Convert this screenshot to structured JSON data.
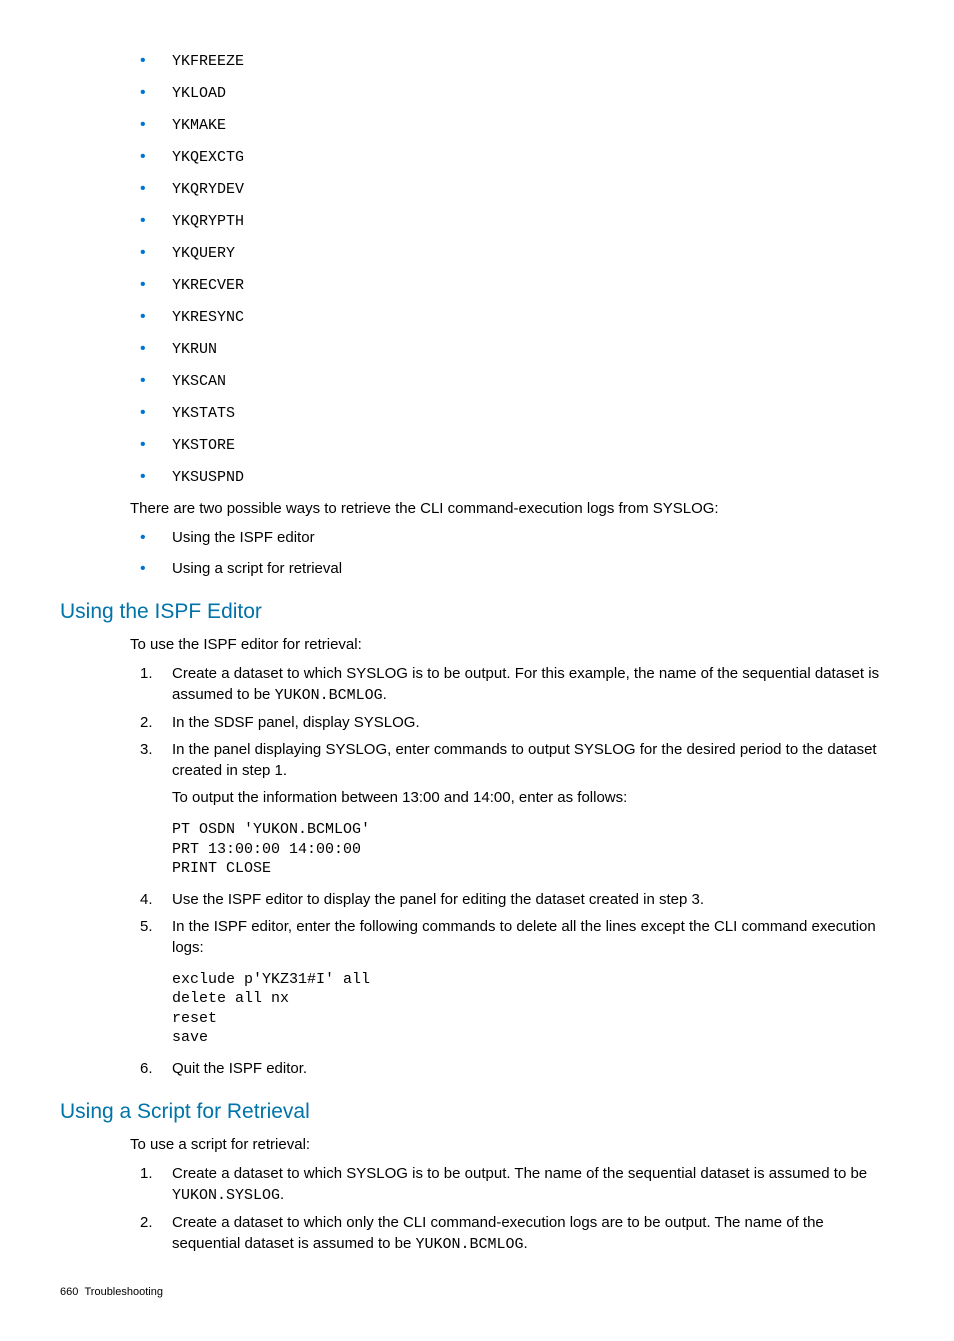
{
  "commands": [
    "YKFREEZE",
    "YKLOAD",
    "YKMAKE",
    "YKQEXCTG",
    "YKQRYDEV",
    "YKQRYPTH",
    "YKQUERY",
    "YKRECVER",
    "YKRESYNC",
    "YKRUN",
    "YKSCAN",
    "YKSTATS",
    "YKSTORE",
    "YKSUSPND"
  ],
  "intro_para": "There are two possible ways to retrieve the CLI command-execution logs from SYSLOG:",
  "intro_bullets": [
    "Using the ISPF editor",
    "Using a script for retrieval"
  ],
  "ispf": {
    "heading": "Using the ISPF Editor",
    "lead": "To use the ISPF editor for retrieval:",
    "step1_a": "Create a dataset to which SYSLOG is to be output. For this example, the name of the sequential dataset is assumed to be ",
    "step1_code": "YUKON.BCMLOG",
    "step1_b": ".",
    "step2": "In the SDSF panel, display SYSLOG.",
    "step3_a": "In the panel displaying SYSLOG, enter commands to output SYSLOG for the desired period to the dataset created in step 1.",
    "step3_b": "To output the information between 13:00 and 14:00, enter as follows:",
    "code1": "PT OSDN 'YUKON.BCMLOG'\nPRT 13:00:00 14:00:00\nPRINT CLOSE",
    "step4": "Use the ISPF editor to display the panel for editing the dataset created in step 3.",
    "step5": "In the ISPF editor, enter the following commands to delete all the lines except the CLI command execution logs:",
    "code2": "exclude p'YKZ31#I' all\ndelete all nx\nreset\nsave",
    "step6": "Quit the ISPF editor."
  },
  "script": {
    "heading": "Using a Script for Retrieval",
    "lead": "To use a script for retrieval:",
    "step1_a": "Create a dataset to which SYSLOG is to be output. The name of the sequential dataset is assumed to be ",
    "step1_code": "YUKON.SYSLOG",
    "step1_b": ".",
    "step2_a": "Create a dataset to which only the CLI command-execution logs are to be output. The name of the sequential dataset is assumed to be ",
    "step2_code": "YUKON.BCMLOG",
    "step2_b": "."
  },
  "footer": {
    "page": "660",
    "section": "Troubleshooting"
  }
}
